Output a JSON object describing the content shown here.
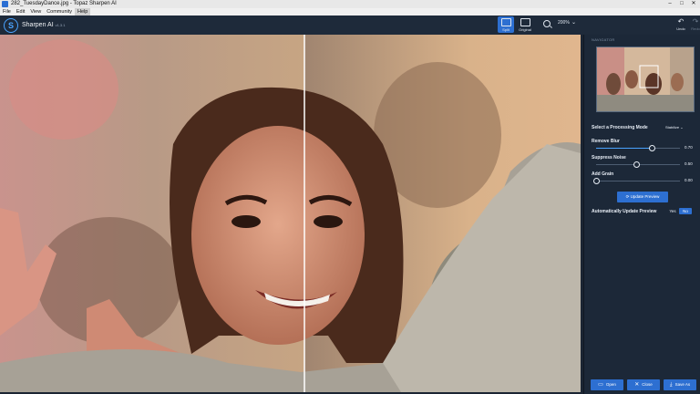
{
  "window": {
    "title": "282_TuesdayDance.jpg - Topaz Sharpen AI",
    "controls": [
      "–",
      "□",
      "✕"
    ]
  },
  "menu": [
    "File",
    "Edit",
    "View",
    "Community",
    "Help"
  ],
  "app": {
    "name": "Sharpen AI",
    "version": "v1.3.1"
  },
  "toolbar": {
    "split_label": "Split",
    "original_label": "Original",
    "zoom_value": "200%",
    "undo_label": "Undo",
    "redo_label": "Redo"
  },
  "panel": {
    "navigator_label": "NAVIGATOR",
    "mode_label": "Select a Processing Mode",
    "mode_value": "Stabilize",
    "sliders": [
      {
        "label": "Remove Blur",
        "value": "0.70",
        "fraction": 0.7
      },
      {
        "label": "Suppress Noise",
        "value": "0.50",
        "fraction": 0.5
      },
      {
        "label": "Add Grain",
        "value": "0.00",
        "fraction": 0.0
      }
    ],
    "update_label": "Update Preview",
    "auto_update_label": "Automatically Update Preview",
    "auto_yes": "Yes",
    "auto_no": "No"
  },
  "bottom": {
    "open_label": "Open",
    "close_label": "Close",
    "save_label": "Save As"
  },
  "colors": {
    "accent": "#2d6fd1",
    "panel_bg": "#1c2838",
    "toolbar_bg": "#1e2a3a"
  }
}
